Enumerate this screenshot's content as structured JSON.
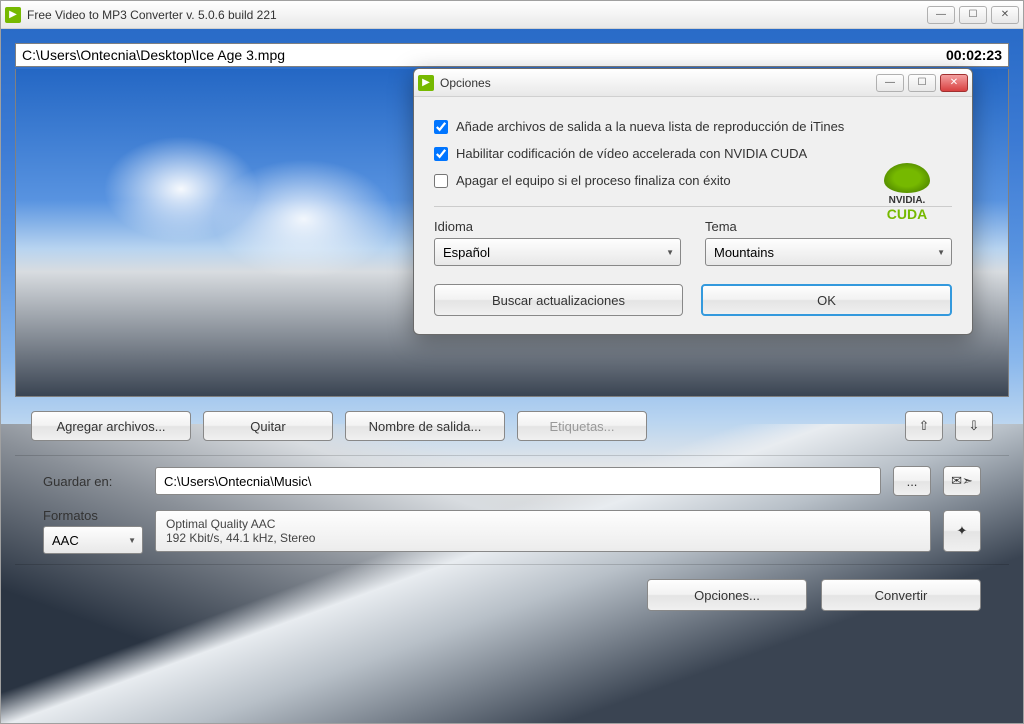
{
  "app": {
    "title": "Free Video to MP3 Converter  v. 5.0.6 build 221"
  },
  "preview": {
    "path": "C:\\Users\\Ontecnia\\Desktop\\Ice Age 3.mpg",
    "duration": "00:02:23"
  },
  "toolbar": {
    "add_files": "Agregar archivos...",
    "remove": "Quitar",
    "output_name": "Nombre de salida...",
    "tags": "Etiquetas...",
    "up": "⇧",
    "down": "⇩"
  },
  "save": {
    "label": "Guardar en:",
    "path": "C:\\Users\\Ontecnia\\Music\\",
    "browse": "..."
  },
  "formats": {
    "label": "Formatos",
    "selected": "AAC",
    "quality_line1": "Optimal Quality AAC",
    "quality_line2": "192 Kbit/s, 44.1 kHz, Stereo"
  },
  "bottom": {
    "options": "Opciones...",
    "convert": "Convertir"
  },
  "dialog": {
    "title": "Opciones",
    "check_itunes": "Añade archivos de salida a la nueva lista de reproducción de iTines",
    "check_cuda": "Habilitar codificación de vídeo accelerada con NVIDIA CUDA",
    "check_shutdown": "Apagar el equipo si el proceso finaliza con éxito",
    "cuda_brand": "NVIDIA.",
    "cuda_name": "CUDA",
    "language_label": "Idioma",
    "language_value": "Español",
    "theme_label": "Tema",
    "theme_value": "Mountains",
    "check_updates": "Buscar actualizaciones",
    "ok": "OK"
  }
}
